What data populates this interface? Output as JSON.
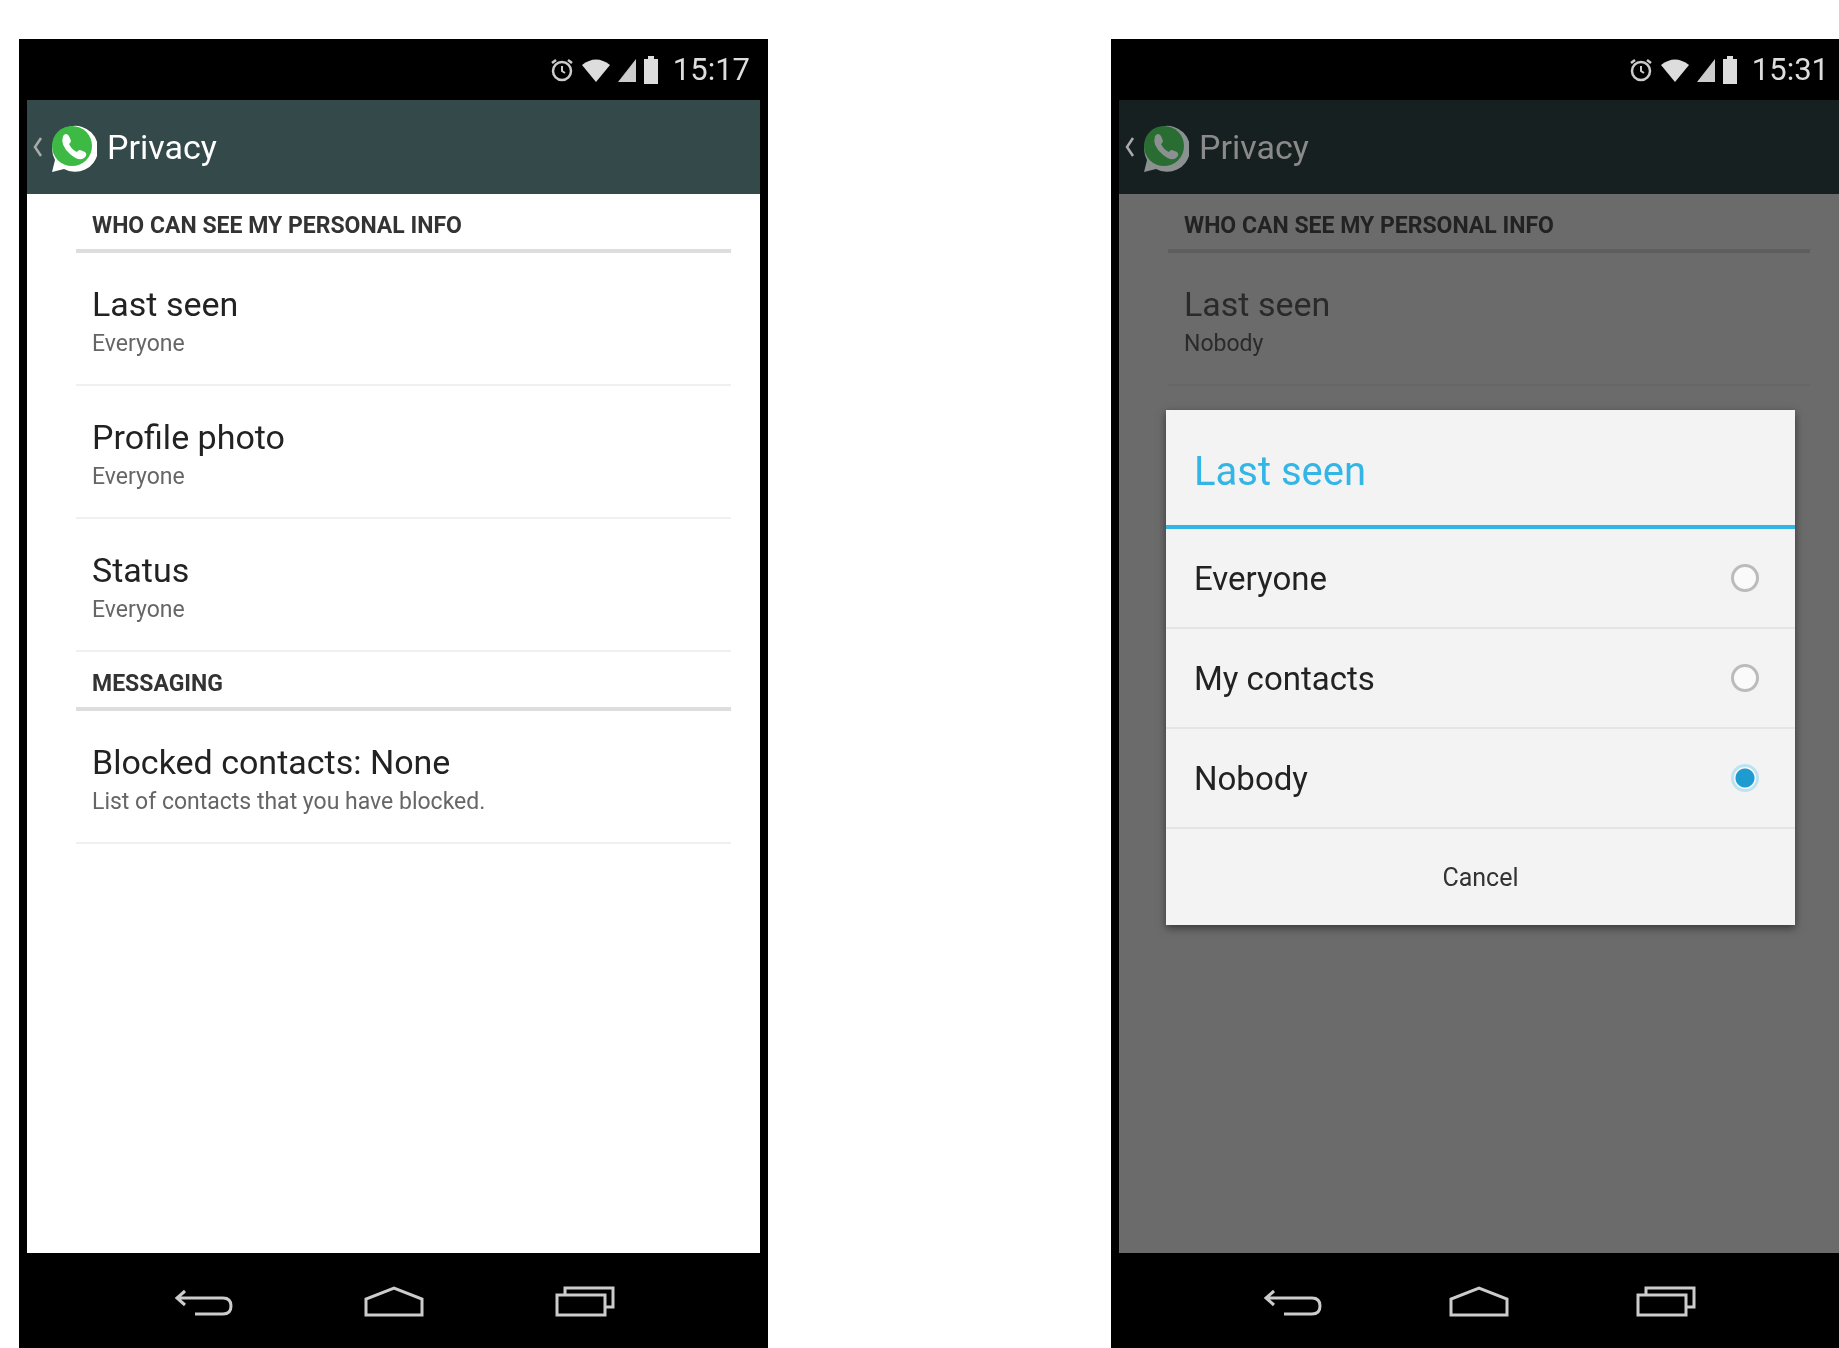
{
  "screens": [
    {
      "status_bar": {
        "time": "15:17"
      },
      "app_bar": {
        "title": "Privacy"
      },
      "dimmed": false,
      "sections": [
        {
          "header": "WHO CAN SEE MY PERSONAL INFO",
          "items": [
            {
              "title": "Last seen",
              "summary": "Everyone"
            },
            {
              "title": "Profile photo",
              "summary": "Everyone"
            },
            {
              "title": "Status",
              "summary": "Everyone"
            }
          ]
        },
        {
          "header": "MESSAGING",
          "items": [
            {
              "title": "Blocked contacts: None",
              "summary": "List of contacts that you have blocked."
            }
          ]
        }
      ]
    },
    {
      "status_bar": {
        "time": "15:31"
      },
      "app_bar": {
        "title": "Privacy"
      },
      "dimmed": true,
      "sections": [
        {
          "header": "WHO CAN SEE MY PERSONAL INFO",
          "items": [
            {
              "title": "Last seen",
              "summary": "Nobody"
            }
          ]
        }
      ],
      "dialog": {
        "title": "Last seen",
        "options": [
          {
            "label": "Everyone",
            "selected": false
          },
          {
            "label": "My contacts",
            "selected": false
          },
          {
            "label": "Nobody",
            "selected": true
          }
        ],
        "button": "Cancel"
      }
    }
  ]
}
